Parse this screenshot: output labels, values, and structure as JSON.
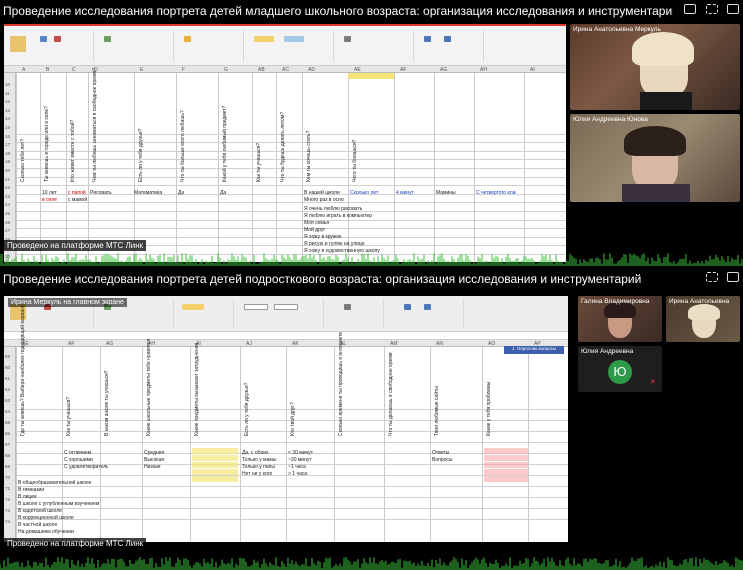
{
  "top_panel": {
    "title": "Проведение исследования портрета детей младшего школьного возраста: организация исследования и инструментарий",
    "watermark": "Проведено на платформе МТС Линк",
    "participants": [
      {
        "name": "Ирина Анатольевна Меркуль"
      },
      {
        "name": "Юлия Андреевна Юнова"
      }
    ],
    "row_numbers": [
      "10",
      "11",
      "12",
      "13",
      "14",
      "15",
      "16",
      "17",
      "18",
      "19",
      "20",
      "21",
      "22",
      "23",
      "24",
      "25",
      "26",
      "27",
      "28",
      "29",
      "30",
      "31"
    ],
    "col_letters": [
      "A",
      "B",
      "C",
      "D",
      "E",
      "F",
      "G",
      "AB",
      "AC",
      "AD",
      "AE",
      "AF",
      "AG",
      "AH",
      "AI"
    ],
    "vertical_headers": [
      "Сколько тебе лет?",
      "Ты живешь в городе или в селе?",
      "Кто живет вместе с тобой?",
      "Чем ты любишь заниматься в свободное время?",
      "Есть ли у тебя друзья?",
      "Что ты больше всего любишь?",
      "Какой у тебя любимый предмет?",
      "Как ты учишься?",
      "Что ты будешь делать летом?",
      "Кем ты хочешь стать?",
      "Чего ты боишься?"
    ],
    "cells": [
      "10 лет",
      "в селе",
      "с папой",
      "с мамой",
      "Рисовать",
      "Да",
      "Да",
      "Математика",
      "В нашей школе",
      "Много раз в основном в селе",
      "Сколько лет",
      "4 минут",
      "Мамины",
      "С четвертого класса"
    ],
    "list_items": [
      "Я очень люблю рисовать",
      "Я люблю играть в компьютер",
      "Моя семья",
      "Мой друг",
      "Я хожу в кружок",
      "Я рисую и гуляю на улице",
      "Я хожу в художественную школу"
    ]
  },
  "bottom_panel": {
    "title": "Проведение исследования портрета детей подросткового возраста: организация исследования и инструментарий",
    "presenter_label": "Ирина Меркуль на главном экране",
    "watermark": "Проведено на платформе МТС Линк",
    "participants": [
      {
        "name": "Галина Владимировна"
      },
      {
        "name": "Ирина Анатольевна"
      },
      {
        "name": "Юлия Андреевна",
        "initial": "Ю"
      }
    ],
    "row_numbers": [
      "59",
      "60",
      "61",
      "62",
      "63",
      "64",
      "65",
      "66",
      "67",
      "68",
      "69",
      "70",
      "71",
      "72",
      "73",
      "74"
    ],
    "col_letters": [
      "AE",
      "AF",
      "AG",
      "AH",
      "AI",
      "AJ",
      "AK",
      "AL",
      "AM",
      "AN",
      "AO",
      "AP"
    ],
    "vertical_headers": [
      "Где ты живешь? Выбери наиболее подходящий вариант",
      "Как ты учишься?",
      "В каком школе ты учишься?",
      "Какие школьные предметы тебе нравятся",
      "Какие предметы вызывают затруднения",
      "Есть ли у тебя друзья?",
      "Кто твой друг?",
      "Сколько времени ты проводишь в интернете",
      "Что ты делаешь в свободное время",
      "Твои любимые сайты",
      "Какие у тебя проблемы"
    ],
    "cells": [
      "Да, с обоих",
      "Только у мамы",
      "Только у папы",
      "Нет ни у кого",
      "< 30 минут",
      "~30 минут",
      "~1 часа",
      "> 1 часа",
      "С отличием",
      "С хорошими",
      "С удовлетворительными",
      "Средняя",
      "Высокая",
      "Низкая",
      "Ответы",
      "Вопросы"
    ],
    "list_items": [
      "В общеобразовательной школе",
      "В гимназии",
      "В лицее",
      "В школе с углубленным изучением",
      "В кадетской школе",
      "В коррекционной школе",
      "В частной школе",
      "На домашнем обучении"
    ],
    "sheet_tab": "1. Опросник вопросы"
  }
}
